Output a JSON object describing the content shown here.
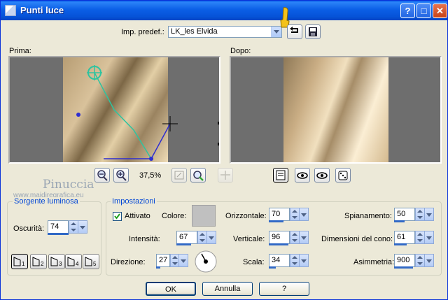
{
  "window": {
    "title": "Punti luce"
  },
  "preset": {
    "label": "Imp. predef.:",
    "value": "LK_les Elvida"
  },
  "preview": {
    "before_label": "Prima:",
    "after_label": "Dopo:",
    "zoom": "37,5%"
  },
  "watermark": {
    "name": "Pinuccia",
    "url": "www.maidiregrafica.eu"
  },
  "light_source": {
    "title": "Sorgente luminosa",
    "darkness_label": "Oscurità:",
    "darkness_value": "74",
    "lights": [
      "1",
      "2",
      "3",
      "4",
      "5"
    ]
  },
  "settings": {
    "title": "Impostazioni",
    "enabled_label": "Attivato",
    "color_label": "Colore:",
    "intensity_label": "Intensità:",
    "intensity_value": "67",
    "direction_label": "Direzione:",
    "direction_value": "27",
    "horizontal_label": "Orizzontale:",
    "horizontal_value": "70",
    "vertical_label": "Verticale:",
    "vertical_value": "96",
    "scale_label": "Scala:",
    "scale_value": "34",
    "flatness_label": "Spianamento:",
    "flatness_value": "50",
    "cone_label": "Dimensioni del cono:",
    "cone_value": "61",
    "asymmetry_label": "Asimmetria:",
    "asymmetry_value": "900"
  },
  "buttons": {
    "ok": "OK",
    "cancel": "Annulla",
    "help": "?"
  },
  "colors": {
    "accent": "#0a5ee9",
    "group_title": "#0046d5",
    "light_color": "#c0c0c0"
  }
}
